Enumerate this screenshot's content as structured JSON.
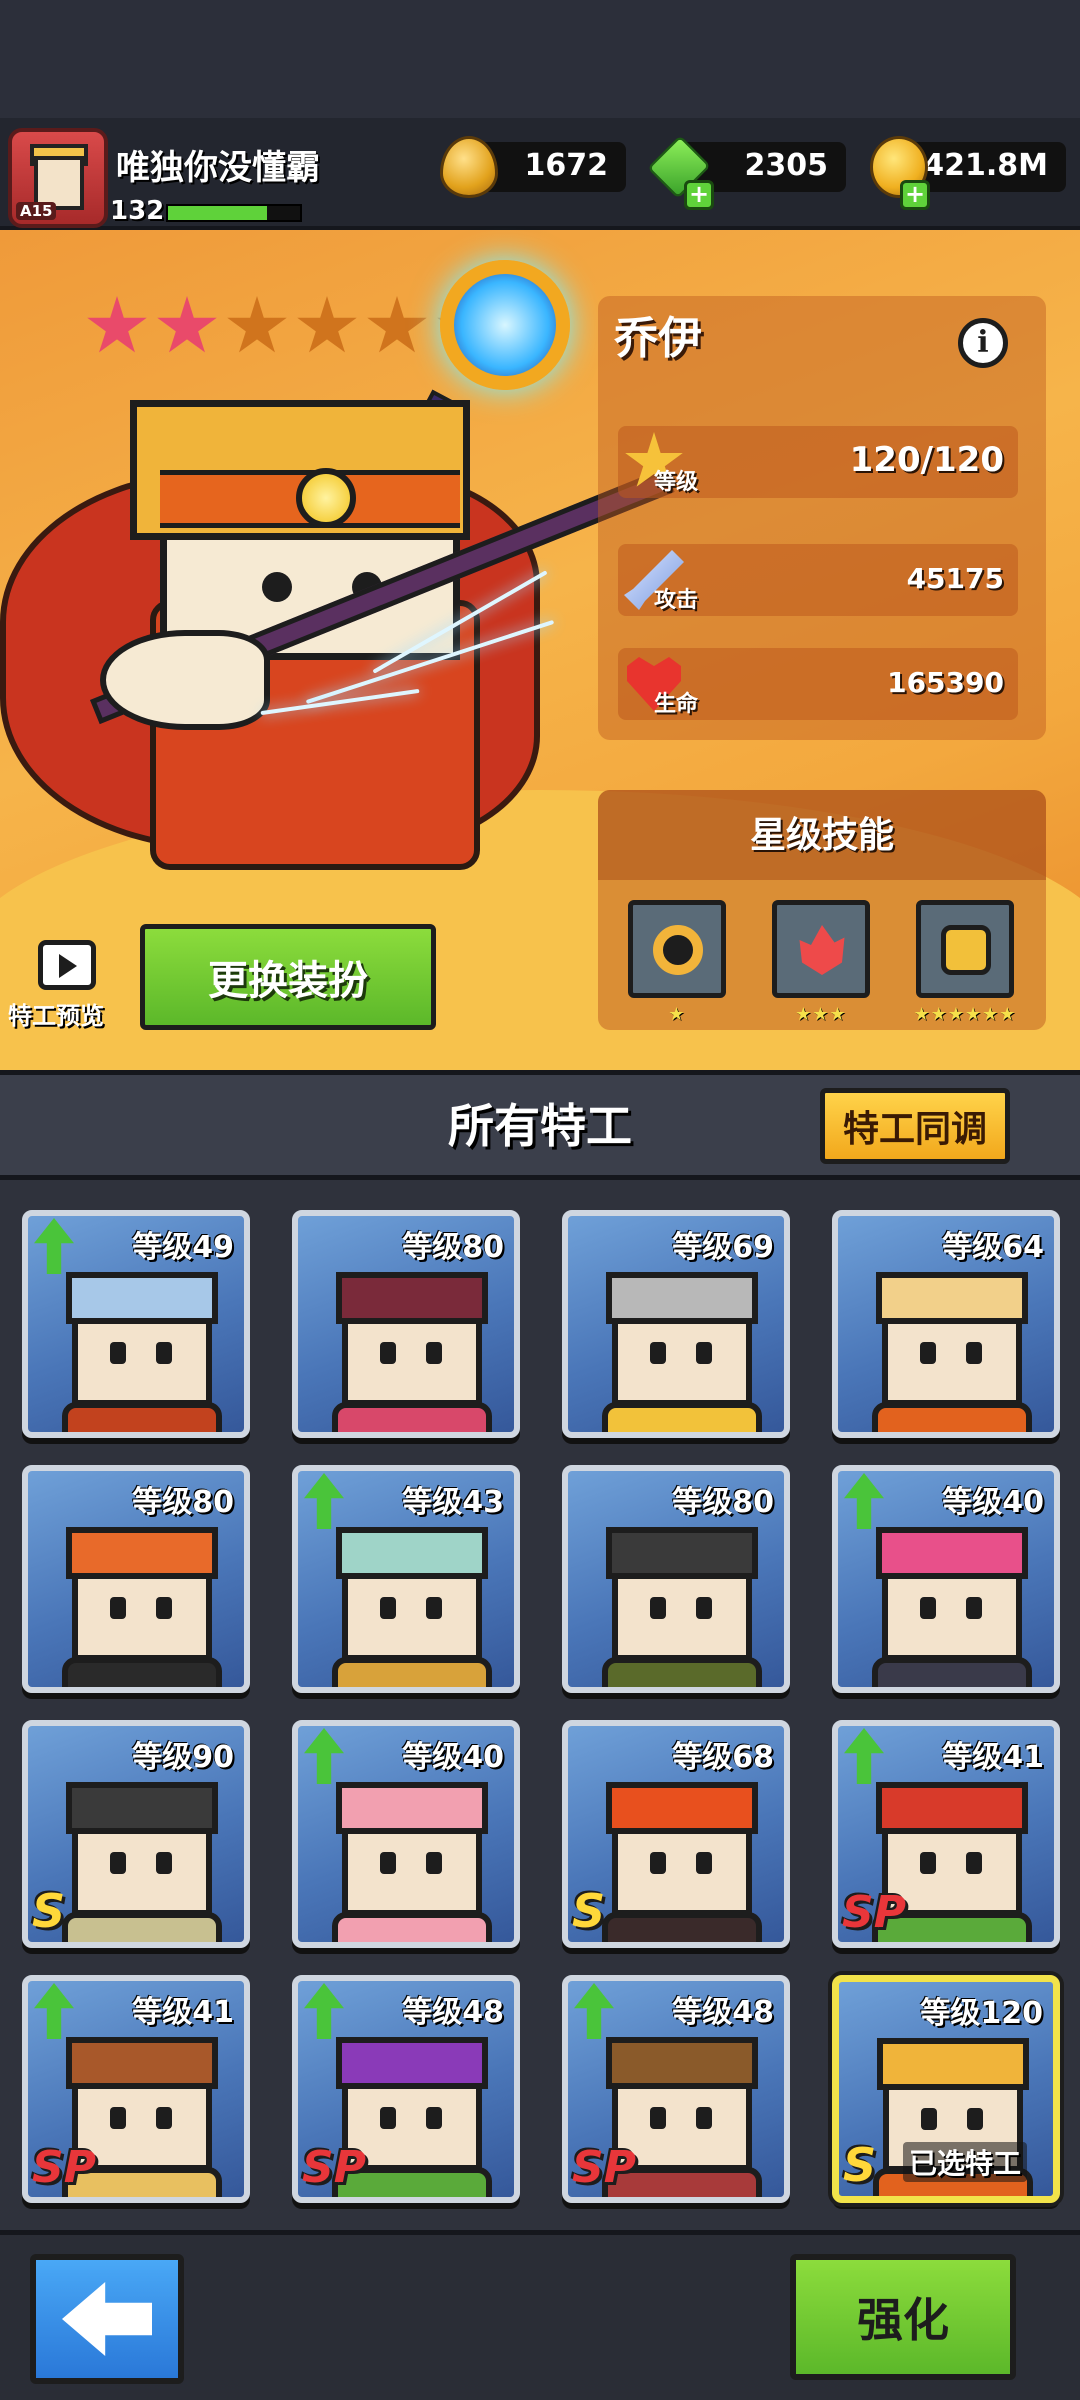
{
  "player": {
    "name": "唯独你没懂霸",
    "level": "132",
    "avatar_badge": "A15",
    "xp_progress": 0.75
  },
  "resources": [
    {
      "name": "drop-icon",
      "value": "1672",
      "add": false
    },
    {
      "name": "gem-icon",
      "value": "2305",
      "add": true
    },
    {
      "name": "coin-icon",
      "value": "421.8M",
      "add": true
    }
  ],
  "hero": {
    "name": "乔伊",
    "stars_total": 6,
    "stars_filled": 2,
    "stats": [
      {
        "icon": "level-star-icon",
        "label": "等级",
        "value": "120/120"
      },
      {
        "icon": "sword-icon",
        "label": "攻击",
        "value": "45175"
      },
      {
        "icon": "heart-icon",
        "label": "生命",
        "value": "165390"
      }
    ],
    "skills_title": "星级技能",
    "skills": [
      {
        "icon": "ring-skill-icon",
        "stars": "★"
      },
      {
        "icon": "flame-skill-icon",
        "stars": "★★★"
      },
      {
        "icon": "fist-skill-icon",
        "stars": "★★★★★★"
      }
    ],
    "preview_label": "特工预览",
    "outfit_button": "更换装扮"
  },
  "list": {
    "title": "所有特工",
    "sync_button": "特工同调"
  },
  "agents": [
    {
      "level": "等级49",
      "upgrade": true,
      "grade": "",
      "hair": "#a7c8e8",
      "torso": "#c2421e",
      "selected": false
    },
    {
      "level": "等级80",
      "upgrade": false,
      "grade": "",
      "hair": "#7a2a3a",
      "torso": "#d8486a",
      "selected": false
    },
    {
      "level": "等级69",
      "upgrade": false,
      "grade": "",
      "hair": "#b8b8b8",
      "torso": "#f2c23a",
      "selected": false
    },
    {
      "level": "等级64",
      "upgrade": false,
      "grade": "",
      "hair": "#f2d08a",
      "torso": "#e2621e",
      "selected": false
    },
    {
      "level": "等级80",
      "upgrade": false,
      "grade": "",
      "hair": "#e86a2a",
      "torso": "#2a2a2a",
      "selected": false
    },
    {
      "level": "等级43",
      "upgrade": true,
      "grade": "",
      "hair": "#9fd4c8",
      "torso": "#d8a23a",
      "selected": false
    },
    {
      "level": "等级80",
      "upgrade": false,
      "grade": "",
      "hair": "#3a3a3a",
      "torso": "#5a6a2a",
      "selected": false
    },
    {
      "level": "等级40",
      "upgrade": true,
      "grade": "",
      "hair": "#e8508a",
      "torso": "#3a3a4a",
      "selected": false
    },
    {
      "level": "等级90",
      "upgrade": false,
      "grade": "S",
      "hair": "#3a3a3a",
      "torso": "#c8c090",
      "selected": false
    },
    {
      "level": "等级40",
      "upgrade": true,
      "grade": "",
      "hair": "#f2a0b0",
      "torso": "#f2a0b0",
      "selected": false
    },
    {
      "level": "等级68",
      "upgrade": false,
      "grade": "S",
      "hair": "#e8501e",
      "torso": "#3a2a2a",
      "selected": false
    },
    {
      "level": "等级41",
      "upgrade": true,
      "grade": "SP",
      "hair": "#d83a2a",
      "torso": "#5aaa3a",
      "selected": false
    },
    {
      "level": "等级41",
      "upgrade": true,
      "grade": "SP",
      "hair": "#a8582a",
      "torso": "#e8c060",
      "selected": false
    },
    {
      "level": "等级48",
      "upgrade": true,
      "grade": "SP",
      "hair": "#8a3ab8",
      "torso": "#5aaa3a",
      "selected": false
    },
    {
      "level": "等级48",
      "upgrade": true,
      "grade": "SP",
      "hair": "#8a5a2a",
      "torso": "#a83a3a",
      "selected": false
    },
    {
      "level": "等级120",
      "upgrade": false,
      "grade": "S",
      "hair": "#f0b43a",
      "torso": "#e2621e",
      "selected": true,
      "selected_label": "已选特工"
    }
  ],
  "bottom": {
    "enhance_button": "强化"
  },
  "colors": {
    "hero_bg": "#f3a83e",
    "card_bg": "#4a76b8",
    "accent_green": "#5cb82a",
    "accent_yellow": "#f2a81c",
    "star_on": "#e94a6a"
  }
}
